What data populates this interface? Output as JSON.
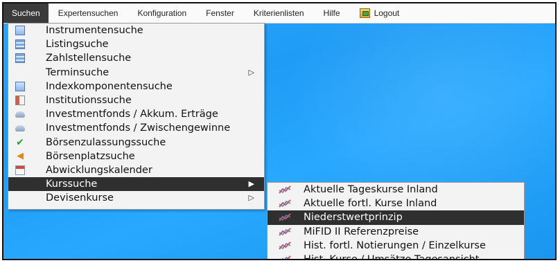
{
  "menubar": {
    "items": [
      {
        "label": "Suchen"
      },
      {
        "label": "Expertensuchen"
      },
      {
        "label": "Konfiguration"
      },
      {
        "label": "Fenster"
      },
      {
        "label": "Kriterienlisten"
      },
      {
        "label": "Hilfe"
      },
      {
        "label": "Logout"
      }
    ]
  },
  "dropdown": {
    "items": [
      {
        "label": "Instrumentensuche",
        "icon": "document-icon"
      },
      {
        "label": "Listingsuche",
        "icon": "list-icon"
      },
      {
        "label": "Zahlstellensuche",
        "icon": "list-icon"
      },
      {
        "label": "Terminsuche",
        "icon": "none",
        "arrow": "▷"
      },
      {
        "label": "Indexkomponentensuche",
        "icon": "document-icon"
      },
      {
        "label": "Institutionssuche",
        "icon": "institution-icon"
      },
      {
        "label": "Investmentfonds / Akkum. Erträge",
        "icon": "cloud-icon"
      },
      {
        "label": "Investmentfonds / Zwischengewinne",
        "icon": "cloud-icon"
      },
      {
        "label": "Börsenzulassungssuche",
        "icon": "checkmark-icon"
      },
      {
        "label": "Börsenplatzsuche",
        "icon": "horn-icon"
      },
      {
        "label": "Abwicklungskalender",
        "icon": "calendar-icon"
      },
      {
        "label": "Kurssuche",
        "icon": "none",
        "arrow": "▶",
        "selected": true
      },
      {
        "label": "Devisenkurse",
        "icon": "none",
        "arrow": "▷"
      }
    ]
  },
  "submenu": {
    "items": [
      {
        "label": "Aktuelle Tageskurse Inland",
        "icon": "chart-icon"
      },
      {
        "label": "Aktuelle fortl. Kurse Inland",
        "icon": "chart-icon"
      },
      {
        "label": "Niederstwertprinzip",
        "icon": "chart-icon",
        "selected": true
      },
      {
        "label": "MiFID II Referenzpreise",
        "icon": "chart-icon"
      },
      {
        "label": "Hist. fortl. Notierungen / Einzelkurse",
        "icon": "chart-icon"
      },
      {
        "label": "Hist. Kurse / Umsätze Tagesansicht",
        "icon": "chart-icon"
      }
    ]
  },
  "colors": {
    "desktop": "#1f9cf5",
    "menu_bg": "#f3f3f3",
    "selected_bg": "#2f2f2f"
  }
}
